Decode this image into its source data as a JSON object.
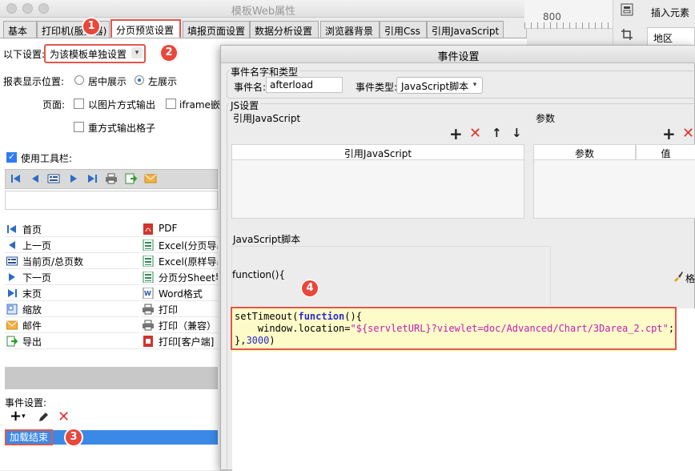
{
  "main_dialog": {
    "title": "模板Web属性",
    "tabs": [
      {
        "label": "基本"
      },
      {
        "label": "打印机(服务器)"
      },
      {
        "label": "分页预览设置"
      },
      {
        "label": "填报页面设置"
      },
      {
        "label": "数据分析设置"
      },
      {
        "label": "浏览器背景"
      },
      {
        "label": "引用Css"
      },
      {
        "label": "引用JavaScript"
      }
    ],
    "settings_label": "以下设置:",
    "settings_value": "为该模板单独设置",
    "report_pos_label": "报表显示位置:",
    "radio_center": "居中展示",
    "radio_left": "左展示",
    "page_label": "页面:",
    "cb_image_output": "以图片方式输出",
    "cb_iframe": "iframe嵌入",
    "cb_repeat_grid": "重方式输出格子",
    "use_toolbar": "使用工具栏:",
    "toolbar_items": [
      {
        "icon": "first-page-icon",
        "label": "首页"
      },
      {
        "icon": "pdf-icon",
        "label": "PDF"
      },
      {
        "icon": "prev-page-icon",
        "label": "上一页"
      },
      {
        "icon": "excel-icon",
        "label": "Excel(分页导出)"
      },
      {
        "icon": "page-count-icon",
        "label": "当前页/总页数"
      },
      {
        "icon": "excel-icon",
        "label": "Excel(原样导出)"
      },
      {
        "icon": "next-page-icon",
        "label": "下一页"
      },
      {
        "icon": "excel-sheet-icon",
        "label": "分页分Sheet导出"
      },
      {
        "icon": "last-page-icon",
        "label": "末页"
      },
      {
        "icon": "word-icon",
        "label": "Word格式"
      },
      {
        "icon": "zoom-icon",
        "label": "缩放"
      },
      {
        "icon": "print-icon",
        "label": "打印"
      },
      {
        "icon": "mail-icon",
        "label": "邮件"
      },
      {
        "icon": "print-icon",
        "label": "打印（兼容）"
      },
      {
        "icon": "export-icon",
        "label": "导出"
      },
      {
        "icon": "print-client-icon",
        "label": "打印[客户端]"
      }
    ],
    "event_settings_label": "事件设置:",
    "event_item": "加载结束"
  },
  "badges": [
    "1",
    "2",
    "3",
    "4"
  ],
  "editor": {
    "ruler_number": "800",
    "insert_element": "插入元素",
    "region": "地区"
  },
  "event_dialog": {
    "title": "事件设置",
    "group_name_type": "事件名字和类型",
    "event_name_label": "事件名:",
    "event_name_value": "afterload",
    "event_type_label": "事件类型:",
    "event_type_value": "JavaScript脚本",
    "js_settings": "JS设置",
    "ref_js_label": "引用JavaScript",
    "params_label": "参数",
    "ref_js_header": "引用JavaScript",
    "params_header": "参数",
    "value_header": "值",
    "js_script_label": "JavaScript脚本",
    "function_header": "function(){",
    "format_label": "格",
    "code_line1_fn": "setTimeout(",
    "code_line1_kw": "function",
    "code_line1_end": "(){",
    "code_line2_pre": "    window.location=",
    "code_line2_str": "\"${servletURL}?viewlet=doc/Advanced/Chart/3Darea_2.cpt\"",
    "code_line2_end": ";",
    "code_line3_pre": "},",
    "code_line3_num": "3000",
    "code_line3_end": ")"
  },
  "colors": {
    "accent_red": "#e2574c",
    "selection_blue": "#3b89e6",
    "code_highlight": "#fdfbc8"
  }
}
